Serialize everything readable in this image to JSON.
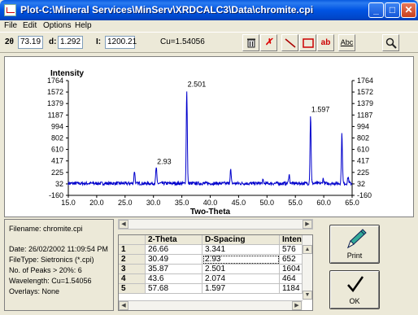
{
  "window": {
    "title": "Plot-C:\\Mineral Services\\MinServ\\XRDCALC3\\Data\\chromite.cpi"
  },
  "menu": [
    "File",
    "Edit",
    "Options",
    "Help"
  ],
  "toolbar": {
    "two_theta_label": "2θ",
    "two_theta_value": "73.19",
    "d_label": "d:",
    "d_value": "1.292",
    "i_label": "I:",
    "i_value": "1200.21",
    "cu_text": "Cu=1.54056",
    "icons": [
      "trash-icon",
      "delete-x-icon",
      "line-icon",
      "rectangle-icon",
      "text-ab-icon",
      "text-abc-icon",
      "zoom-icon"
    ],
    "ab_label": "ab",
    "abc_label": "Abc"
  },
  "chart_data": {
    "type": "line",
    "ylabel": "Intensity",
    "xlabel": "Two-Theta",
    "xlim": [
      15.0,
      65.0
    ],
    "ylim": [
      -160,
      1764
    ],
    "xticks": [
      "15.0",
      "20.0",
      "25.0",
      "30.0",
      "35.0",
      "40.0",
      "45.0",
      "50.0",
      "55.0",
      "60.0",
      "65.0"
    ],
    "yticks": [
      "1764",
      "1572",
      "1379",
      "1187",
      "994",
      "802",
      "610",
      "417",
      "225",
      "32",
      "-160"
    ],
    "baseline": 40,
    "peaks": [
      {
        "x": 26.66,
        "y": 250
      },
      {
        "x": 30.49,
        "y": 310
      },
      {
        "x": 35.87,
        "y": 1604
      },
      {
        "x": 43.6,
        "y": 270
      },
      {
        "x": 49.3,
        "y": 90
      },
      {
        "x": 53.9,
        "y": 200
      },
      {
        "x": 57.68,
        "y": 1184
      },
      {
        "x": 59.9,
        "y": 120
      },
      {
        "x": 63.2,
        "y": 880
      },
      {
        "x": 64.3,
        "y": 150
      }
    ],
    "peak_labels": [
      {
        "x": 30.49,
        "y": 310,
        "text": "2.93"
      },
      {
        "x": 35.87,
        "y": 1604,
        "text": "2.501"
      },
      {
        "x": 57.68,
        "y": 1184,
        "text": "1.597"
      }
    ],
    "line_color": "#0000cc"
  },
  "info": {
    "filename": "Filename: chromite.cpi",
    "date": "Date: 26/02/2002 11:09:54 PM",
    "filetype": "FileType: Sietronics (*.cpi)",
    "peaks": "No. of Peaks > 20%: 6",
    "wavelength": "Wavelength: Cu=1.54056",
    "overlays": "Overlays: None"
  },
  "table": {
    "headers": [
      "2-Theta",
      "D-Spacing",
      "Inten"
    ],
    "rows": [
      {
        "index": "1",
        "cells": [
          "26.66",
          "3.341",
          "576"
        ]
      },
      {
        "index": "2",
        "cells": [
          "30.49",
          "2.93",
          "652"
        ]
      },
      {
        "index": "3",
        "cells": [
          "35.87",
          "2.501",
          "1604"
        ]
      },
      {
        "index": "4",
        "cells": [
          "43.6",
          "2.074",
          "464"
        ]
      },
      {
        "index": "5",
        "cells": [
          "57.68",
          "1.597",
          "1184"
        ]
      }
    ]
  },
  "buttons": {
    "print": "Print",
    "ok": "OK"
  }
}
